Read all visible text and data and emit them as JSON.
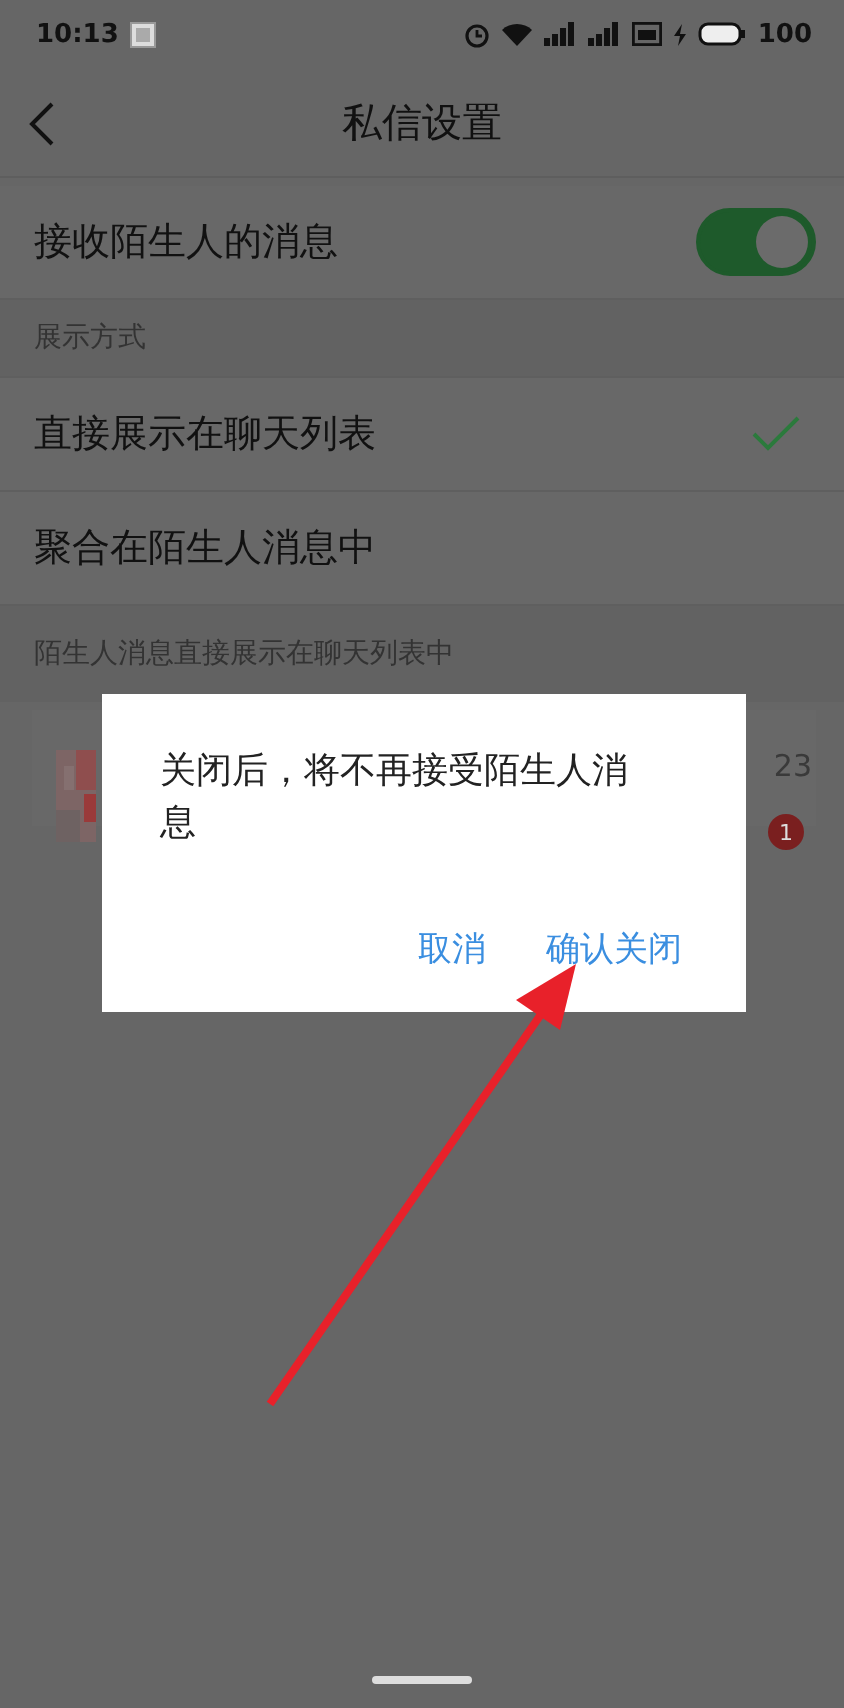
{
  "status_bar": {
    "time": "10:13",
    "battery": "100"
  },
  "nav": {
    "title": "私信设置"
  },
  "receive_toggle": {
    "label": "接收陌生人的消息",
    "on": true
  },
  "display_section": {
    "label": "展示方式",
    "options": [
      {
        "label": "直接展示在聊天列表",
        "selected": true
      },
      {
        "label": "聚合在陌生人消息中",
        "selected": false
      }
    ]
  },
  "preview": {
    "label": "陌生人消息直接展示在聊天列表中",
    "time": "23",
    "badge": "1"
  },
  "dialog": {
    "message": "关闭后，将不再接受陌生人消息",
    "buttons": [
      "取消",
      "确认关闭"
    ]
  }
}
